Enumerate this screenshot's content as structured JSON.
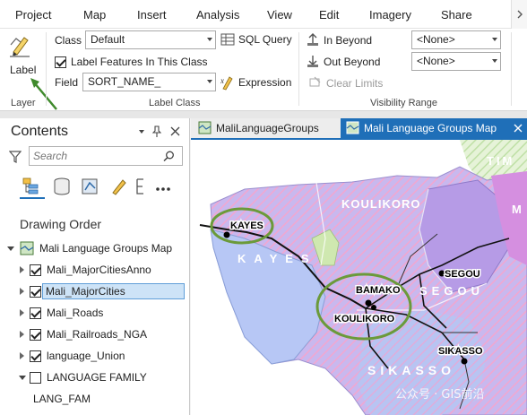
{
  "menu": {
    "items": [
      "Project",
      "Map",
      "Insert",
      "Analysis",
      "View",
      "Edit",
      "Imagery",
      "Share"
    ]
  },
  "ribbon": {
    "layer_group": {
      "label_button": "Label",
      "group_label": "Layer"
    },
    "label_class_group": {
      "class_label": "Class",
      "class_value": "Default",
      "sql_query": "SQL Query",
      "label_features_checkbox": "Label Features In This Class",
      "label_features_checked": true,
      "field_label": "Field",
      "field_value": "SORT_NAME_",
      "expression": "Expression",
      "group_label": "Label Class"
    },
    "visibility_group": {
      "in_beyond": "In Beyond",
      "out_beyond": "Out Beyond",
      "clear_limits": "Clear Limits",
      "in_beyond_value": "<None>",
      "out_beyond_value": "<None>",
      "group_label": "Visibility Range"
    }
  },
  "contents": {
    "title": "Contents",
    "search_placeholder": "Search",
    "drawing_order": "Drawing Order",
    "layers": [
      {
        "name": "Mali Language Groups Map",
        "checked": null,
        "selected": false
      },
      {
        "name": "Mali_MajorCitiesAnno",
        "checked": true,
        "selected": false
      },
      {
        "name": "Mali_MajorCities",
        "checked": true,
        "selected": true
      },
      {
        "name": "Mali_Roads",
        "checked": true,
        "selected": false
      },
      {
        "name": "Mali_Railroads_NGA",
        "checked": true,
        "selected": false
      },
      {
        "name": "language_Union",
        "checked": true,
        "selected": false
      },
      {
        "name": "LANGUAGE FAMILY",
        "checked": false,
        "selected": false
      },
      {
        "name": "LANG_FAM",
        "checked": null,
        "selected": false
      }
    ]
  },
  "map_tabs": [
    {
      "label": "MaliLanguageGroups",
      "active": false
    },
    {
      "label": "Mali Language Groups Map",
      "active": true
    }
  ],
  "map": {
    "regions": [
      "KOULIKORO",
      "KAYES",
      "SEGOU",
      "SIKASSO"
    ],
    "cities": [
      "KAYES",
      "SEGOU",
      "BAMAKO",
      "KOULIKORO",
      "SIKASSO"
    ],
    "partial_labels": [
      "TIM",
      "M"
    ]
  },
  "watermark": "公众号 · GIS前沿",
  "colors": {
    "accent": "#1f6fb8",
    "selection": "#cde3f7",
    "highlight_ring": "#6b9a3a",
    "arrow": "#3f8a2c"
  }
}
